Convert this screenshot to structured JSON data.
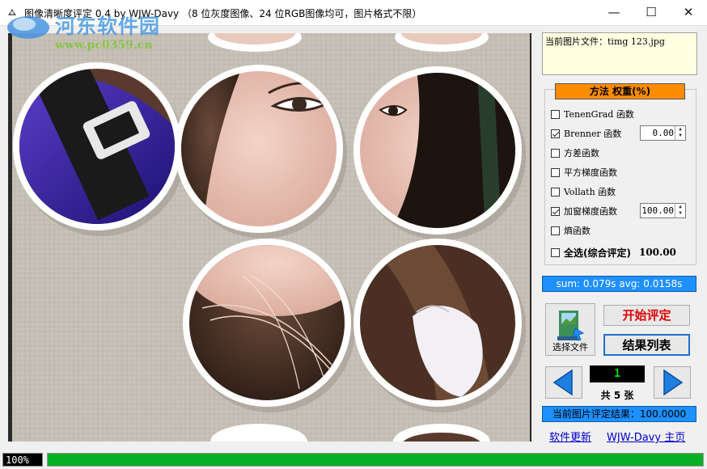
{
  "window": {
    "title": "图像清晰度评定 0.4 by WJW-Davy （8 位灰度图像、24 位RGB图像均可，图片格式不限）",
    "controls": [
      "—",
      "☐",
      "✕"
    ]
  },
  "watermark": {
    "text": "河东软件园",
    "url": "www.pc0359.cn"
  },
  "file_info": {
    "label": "当前图片文件：timg 123.jpg"
  },
  "methods": {
    "header": "方法   权重(%)",
    "options": [
      {
        "label": "TenenGrad 函数",
        "checked": false,
        "weight": null
      },
      {
        "label": "Brenner 函数",
        "checked": true,
        "weight": "0.00"
      },
      {
        "label": "方差函数",
        "checked": false,
        "weight": null
      },
      {
        "label": "平方梯度函数",
        "checked": false,
        "weight": null
      },
      {
        "label": "Vollath 函数",
        "checked": false,
        "weight": null
      },
      {
        "label": "加窗梯度函数",
        "checked": true,
        "weight": "100.00"
      },
      {
        "label": "熵函数",
        "checked": false,
        "weight": null
      }
    ],
    "select_all": {
      "label": "全选(综合评定)",
      "checked": false,
      "total": "100.00"
    }
  },
  "stats": {
    "text": "sum: 0.079s  avg: 0.0158s"
  },
  "buttons": {
    "choose_file": "选择文件",
    "start": "开始评定",
    "result_list": "结果列表"
  },
  "navigation": {
    "current": "1",
    "total_label": "共 5 张"
  },
  "result": {
    "text": "当前图片评定结果：100.0000"
  },
  "links": {
    "update": "软件更新",
    "homepage": "WJW-Davy 主页"
  },
  "statusbar": {
    "percent_label": "100%",
    "progress": 1.0
  },
  "colors": {
    "accent": "#1e90ff",
    "method_header": "#ff8c00",
    "progress": "#06b025",
    "start_text": "#e00000"
  }
}
